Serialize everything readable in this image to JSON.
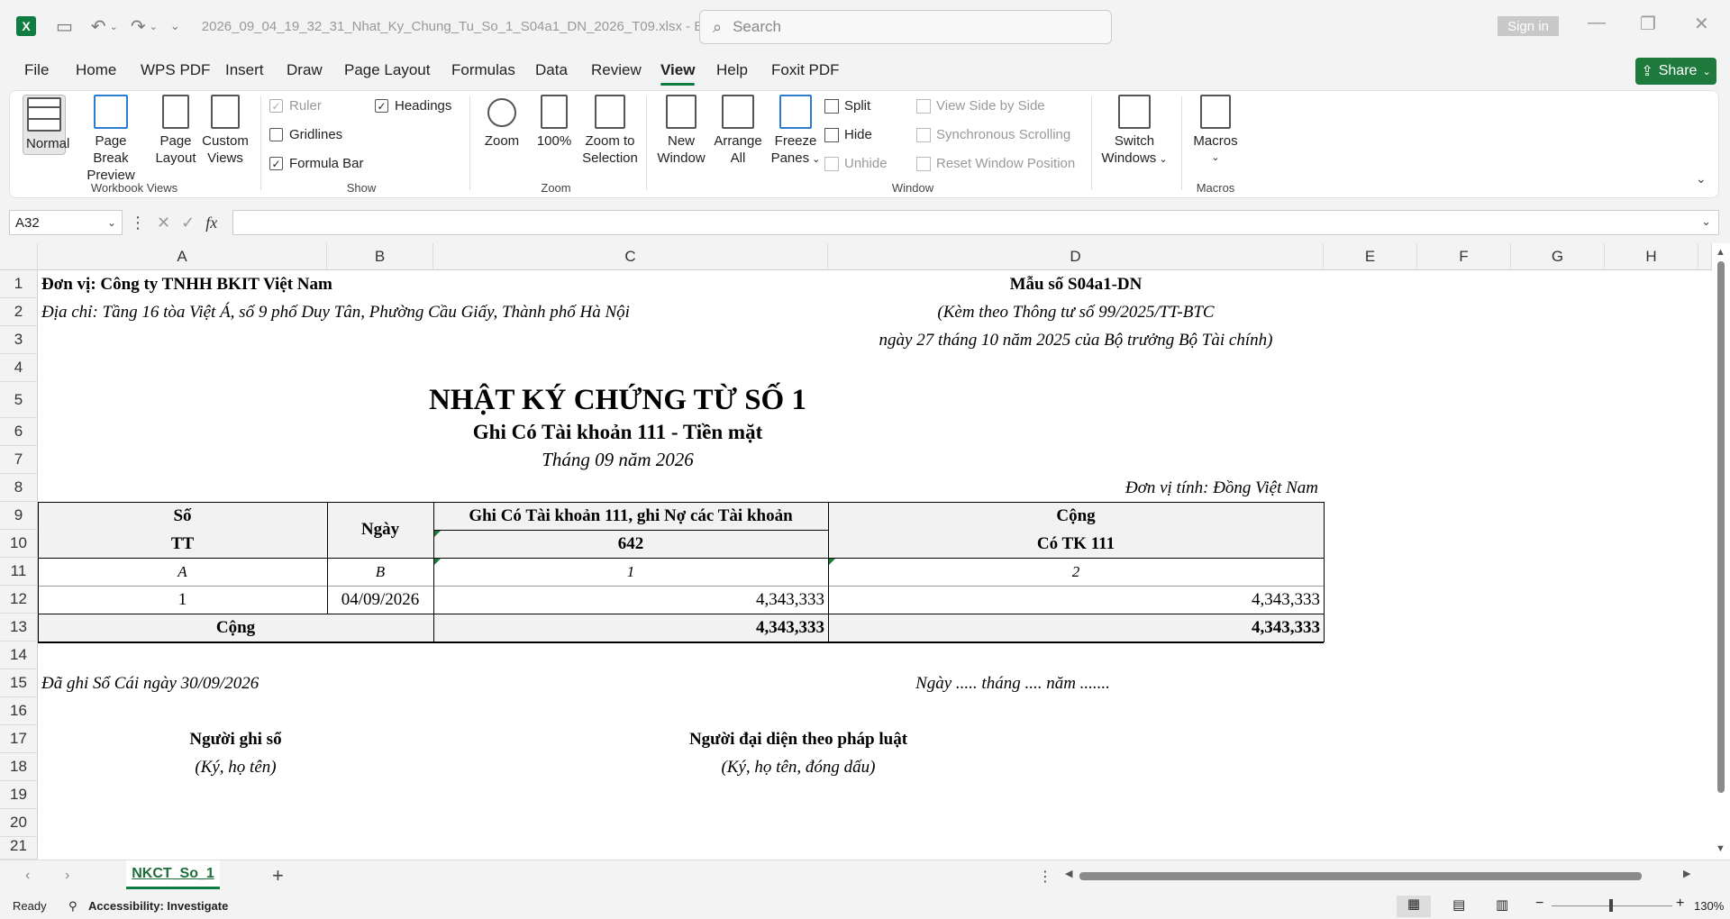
{
  "titlebar": {
    "file_name": "2026_09_04_19_32_31_Nhat_Ky_Chung_Tu_So_1_S04a1_DN_2026_T09.xlsx  -  E...",
    "search_placeholder": "Search",
    "sign_in": "Sign in"
  },
  "menu": [
    "File",
    "Home",
    "WPS PDF",
    "Insert",
    "Draw",
    "Page Layout",
    "Formulas",
    "Data",
    "Review",
    "View",
    "Help",
    "Foxit PDF"
  ],
  "share_label": "Share",
  "ribbon": {
    "workbook_views": {
      "label": "Workbook Views",
      "normal": "Normal",
      "page_break_1": "Page Break",
      "page_break_2": "Preview",
      "page_layout_1": "Page",
      "page_layout_2": "Layout",
      "custom_views_1": "Custom",
      "custom_views_2": "Views"
    },
    "show": {
      "label": "Show",
      "ruler": "Ruler",
      "gridlines": "Gridlines",
      "formula_bar": "Formula Bar",
      "headings": "Headings"
    },
    "zoom": {
      "label": "Zoom",
      "zoom": "Zoom",
      "hundred": "100%",
      "zoom_sel_1": "Zoom to",
      "zoom_sel_2": "Selection"
    },
    "window": {
      "label": "Window",
      "new_window_1": "New",
      "new_window_2": "Window",
      "arrange_all_1": "Arrange",
      "arrange_all_2": "All",
      "freeze_1": "Freeze",
      "freeze_2": "Panes",
      "split": "Split",
      "hide": "Hide",
      "unhide": "Unhide",
      "side_by_side": "View Side by Side",
      "sync_scroll": "Synchronous Scrolling",
      "reset_pos": "Reset Window Position",
      "switch_1": "Switch",
      "switch_2": "Windows"
    },
    "macros": {
      "label": "Macros",
      "macros": "Macros"
    }
  },
  "formula_bar": {
    "name_box": "A32",
    "fx": "fx",
    "value": ""
  },
  "columns": [
    "A",
    "B",
    "C",
    "D",
    "E",
    "F",
    "G",
    "H"
  ],
  "rows": [
    "1",
    "2",
    "3",
    "4",
    "5",
    "6",
    "7",
    "8",
    "9",
    "10",
    "11",
    "12",
    "13",
    "14",
    "15",
    "16",
    "17",
    "18",
    "19",
    "20",
    "21"
  ],
  "sheet": {
    "don_vi": "Đơn vị: Công ty TNHH BKIT Việt Nam",
    "dia_chi": "Địa chỉ: Tầng 16 tòa Việt Á, số 9 phố Duy Tân, Phường Cầu Giấy, Thành phố Hà Nội",
    "mau_so": "Mẫu số S04a1-DN",
    "kem_theo": "(Kèm theo Thông tư số 99/2025/TT-BTC",
    "ngay_tt": "ngày 27 tháng 10 năm 2025 của Bộ trưởng Bộ Tài chính)",
    "title": "NHẬT KÝ CHỨNG TỪ SỐ 1",
    "subtitle": "Ghi Có Tài khoản 111 - Tiền mặt",
    "period": "Tháng 09 năm 2026",
    "unit": "Đơn vị tính: Đồng Việt Nam",
    "hdr_so": "Số",
    "hdr_tt": "TT",
    "hdr_ngay": "Ngày",
    "hdr_ghi_co": "Ghi Có Tài khoản 111, ghi Nợ các Tài khoản",
    "hdr_642": "642",
    "hdr_cong": "Cộng",
    "hdr_co_tk": "Có TK 111",
    "code_a": "A",
    "code_b": "B",
    "code_1": "1",
    "code_2": "2",
    "row1_tt": "1",
    "row1_ngay": "04/09/2026",
    "row1_642": "4,343,333",
    "row1_total": "4,343,333",
    "total_label": "Cộng",
    "total_642": "4,343,333",
    "total_all": "4,343,333",
    "da_ghi": "Đã ghi Sổ Cái ngày 30/09/2026",
    "ngay_ky": "Ngày ..... tháng .... năm .......",
    "nguoi_ghi": "Người ghi sổ",
    "ky_ho_ten": "(Ký, họ tên)",
    "nguoi_dai_dien": "Người đại diện theo pháp luật",
    "ky_dong_dau": "(Ký, họ tên, đóng dấu)"
  },
  "sheet_tab": "NKCT_So_1",
  "status": {
    "ready": "Ready",
    "accessibility": "Accessibility: Investigate",
    "zoom": "130%"
  }
}
